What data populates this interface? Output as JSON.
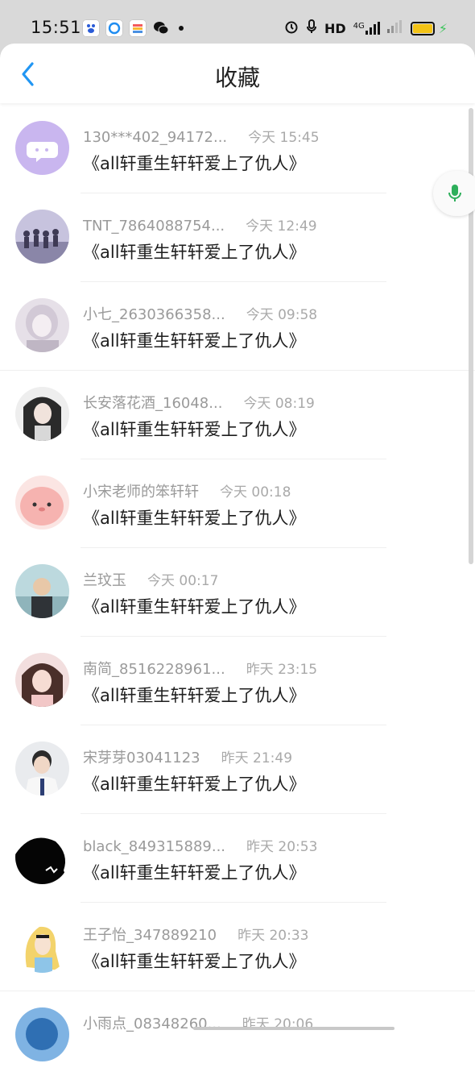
{
  "status_bar": {
    "time": "15:51",
    "network": "HD",
    "signal": "4G",
    "app_icons": [
      "baidu-icon",
      "qq-browser-icon",
      "pinwheel-icon",
      "wechat-icon"
    ],
    "right_icons": [
      "alarm-icon",
      "mic-icon",
      "signal-icon",
      "battery-icon"
    ]
  },
  "header": {
    "title": "收藏",
    "back_icon": "chevron-left-icon"
  },
  "colors": {
    "accent": "#2196f3",
    "mic": "#2eaf5b",
    "meta_text": "#9a9a9a",
    "title_text": "#1e1e1e"
  },
  "items": [
    {
      "name": "130***402_94172...",
      "time": "今天 15:45",
      "title": "《all轩重生轩轩爱上了仇人》"
    },
    {
      "name": "TNT_7864088754...",
      "time": "今天 12:49",
      "title": "《all轩重生轩轩爱上了仇人》"
    },
    {
      "name": "小七_2630366358...",
      "time": "今天 09:58",
      "title": "《all轩重生轩轩爱上了仇人》"
    },
    {
      "name": "长安落花酒_16048...",
      "time": "今天 08:19",
      "title": "《all轩重生轩轩爱上了仇人》"
    },
    {
      "name": "小宋老师的笨轩轩",
      "time": "今天 00:18",
      "title": "《all轩重生轩轩爱上了仇人》"
    },
    {
      "name": "兰玟玉",
      "time": "今天 00:17",
      "title": "《all轩重生轩轩爱上了仇人》"
    },
    {
      "name": "南简_8516228961...",
      "time": "昨天 23:15",
      "title": "《all轩重生轩轩爱上了仇人》"
    },
    {
      "name": "宋芽芽03041123",
      "time": "昨天 21:49",
      "title": "《all轩重生轩轩爱上了仇人》"
    },
    {
      "name": "black_849315889...",
      "time": "昨天 20:53",
      "title": "《all轩重生轩轩爱上了仇人》"
    },
    {
      "name": "王子怡_347889210",
      "time": "昨天 20:33",
      "title": "《all轩重生轩轩爱上了仇人》"
    },
    {
      "name": "小雨点_08348260...",
      "time": "昨天 20:06",
      "title": ""
    }
  ]
}
